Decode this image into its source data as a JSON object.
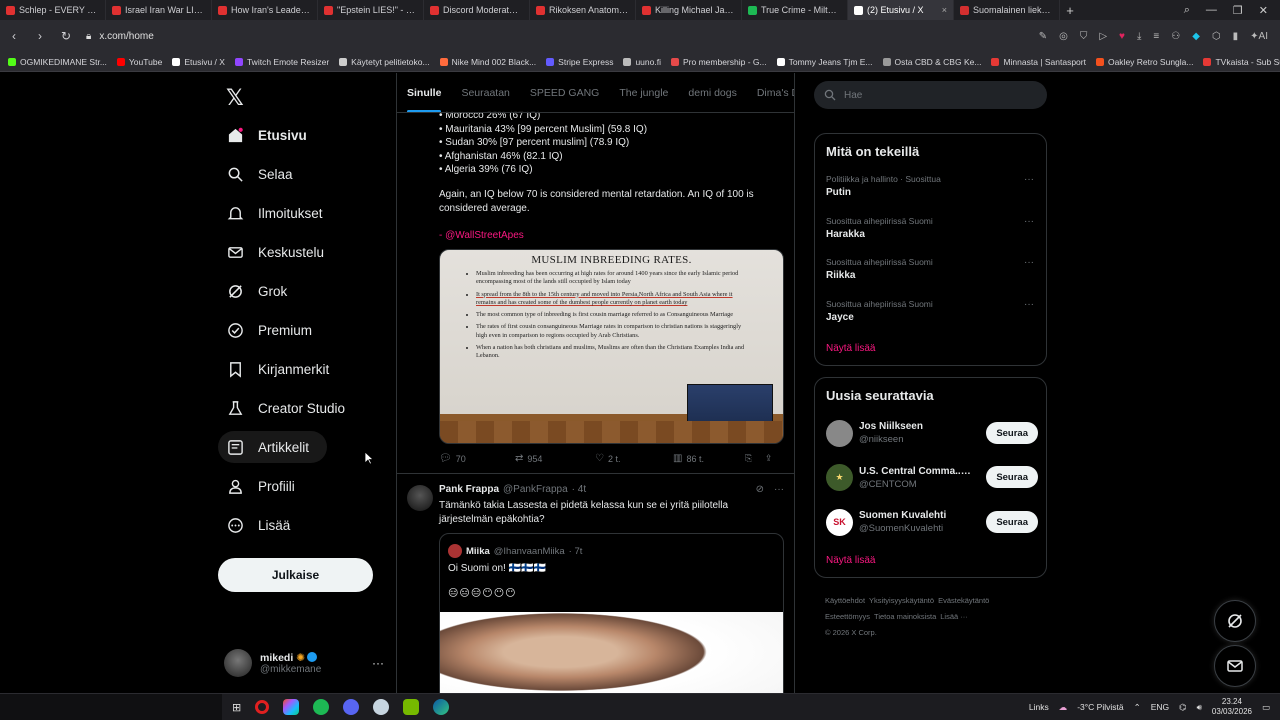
{
  "browser": {
    "tabs": [
      {
        "label": "Schlep - EVERY Parent N",
        "color": "#e03131"
      },
      {
        "label": "Israel Iran War LIVE | Seri",
        "color": "#e03131"
      },
      {
        "label": "How Iran's Leader Was Ki",
        "color": "#e03131"
      },
      {
        "label": "\"Epstein LIES!\" - CIA John",
        "color": "#e03131"
      },
      {
        "label": "Discord Moderator Gets",
        "color": "#e03131"
      },
      {
        "label": "Rikoksen Anatomia | Jam",
        "color": "#e03131"
      },
      {
        "label": "Killing Michael Jackson T",
        "color": "#e03131"
      },
      {
        "label": "True Crime - Miltä tuntu",
        "color": "#1db954"
      },
      {
        "label": "(2) Etusivu / X",
        "color": "#ffffff"
      },
      {
        "label": "Suomalainen liekeissä C",
        "color": "#d32f2f"
      }
    ],
    "url": "x.com/home",
    "bookmarks": [
      {
        "label": "OGMIKEDIMANE Str...",
        "color": "#53fc18"
      },
      {
        "label": "YouTube",
        "color": "#ff0000"
      },
      {
        "label": "Etusivu / X",
        "color": "#ffffff"
      },
      {
        "label": "Twitch Emote Resizer",
        "color": "#9146ff"
      },
      {
        "label": "Käytetyt pelitietoko...",
        "color": "#cccccc"
      },
      {
        "label": "Nike Mind 002 Black...",
        "color": "#ff6b3d"
      },
      {
        "label": "Stripe Express",
        "color": "#635bff"
      },
      {
        "label": "uuno.fi",
        "color": "#bbbbbb"
      },
      {
        "label": "Pro membership - G...",
        "color": "#e64a4a"
      },
      {
        "label": "Tommy Jeans Tjm E...",
        "color": "#ffffff"
      },
      {
        "label": "Osta CBD & CBG Ke...",
        "color": "#999999"
      },
      {
        "label": "Minnasta | Santasport",
        "color": "#e53935"
      },
      {
        "label": "Oakley Retro Sungla...",
        "color": "#f4511e"
      },
      {
        "label": "TVkaista - Sub Suara",
        "color": "#e53935"
      }
    ]
  },
  "nav": {
    "items": [
      {
        "label": "Etusivu",
        "icon": "home-icon",
        "bold": true
      },
      {
        "label": "Selaa",
        "icon": "search-icon"
      },
      {
        "label": "Ilmoitukset",
        "icon": "bell-icon"
      },
      {
        "label": "Keskustelu",
        "icon": "mail-icon"
      },
      {
        "label": "Grok",
        "icon": "grok-icon"
      },
      {
        "label": "Premium",
        "icon": "premium-icon"
      },
      {
        "label": "Kirjanmerkit",
        "icon": "bookmark-icon"
      },
      {
        "label": "Creator Studio",
        "icon": "creator-studio-icon"
      },
      {
        "label": "Artikkelit",
        "icon": "articles-icon"
      },
      {
        "label": "Profiili",
        "icon": "profile-icon"
      },
      {
        "label": "Lisää",
        "icon": "more-icon"
      }
    ],
    "post_label": "Julkaise",
    "account": {
      "name": "mikedi",
      "handle": "@mikkemane"
    }
  },
  "feed": {
    "tabs": [
      "Sinulle",
      "Seuraatan",
      "SPEED GANG",
      "The jungle",
      "demi dogs",
      "Dima's Dist"
    ],
    "tweet1": {
      "lines": [
        "• Morocco 26% (67 IQ)",
        "• Mauritania 43% [99 percent Muslim] (59.8 IQ)",
        "• Sudan 30% [97 percent muslim] (78.9 IQ)",
        "• Afghanistan 46% (82.1 IQ)",
        "• Algeria 39% (76 IQ)"
      ],
      "para": "Again, an IQ below 70 is considered mental retardation. An IQ of 100 is considered average.",
      "mention_prefix": "- ",
      "mention": "@WallStreetApes",
      "image": {
        "title": "MUSLIM INBREEDING RATES.",
        "bullets": [
          "Muslim inbreeding has been occurring at high rates for around 1400 years since the early Islamic period encompassing most of the lands still occupied by Islam today",
          "It spread from the 8th to the 15th century and moved into Persia,North Africa and South Asia where it remains and has created some of the dumbest people currently on planet earth today",
          "The most common type of inbreeding is first cousin marriage referred to as Consanguineous Marriage",
          "The rates of first cousin consanguineous Marriage rates in comparison to christian nations is staggeringly high even in comparison to regions occupied by Arab Christians.",
          "When a nation has both christians and muslims, Muslims are often than the Christians  Examples India and Lebanon."
        ]
      },
      "actions": {
        "replies": "70",
        "reposts": "954",
        "likes": "2 t.",
        "views": "86 t."
      }
    },
    "tweet2": {
      "name": "Pank Frappa",
      "handle": "@PankFrappa",
      "time": "· 4t",
      "text": "Tämänkö takia Lassesta ei pidetä kelassa kun se ei yritä piilotella järjestelmän epäkohtia?",
      "quote": {
        "name": "Miika",
        "handle": "@IhanvaanMiika",
        "time": "· 7t",
        "text": "Oi Suomi on! 🇫🇮🇫🇮🇫🇮",
        "emoji": "😑😑😑😶😶😶"
      }
    }
  },
  "right": {
    "search_placeholder": "Hae",
    "trends_title": "Mitä on tekeillä",
    "trends": [
      {
        "context": "Politiikka ja hallinto · Suosittua",
        "topic": "Putin"
      },
      {
        "context": "Suosittua aihepiirissä Suomi",
        "topic": "Harakka"
      },
      {
        "context": "Suosittua aihepiirissä Suomi",
        "topic": "Riikka"
      },
      {
        "context": "Suosittua aihepiirissä Suomi",
        "topic": "Jayce"
      }
    ],
    "show_more": "Näytä lisää",
    "follow_title": "Uusia seurattavia",
    "follows": [
      {
        "name": "Jos Niilkseen",
        "handle": "@niikseen",
        "verified": false,
        "avatar_color": "#888888",
        "initials": ""
      },
      {
        "name": "U.S. Central Comma...",
        "handle": "@CENTCOM",
        "verified": true,
        "avatar_color": "#3d5a2a",
        "initials": "★"
      },
      {
        "name": "Suomen Kuvalehti",
        "handle": "@SuomenKuvalehti",
        "verified": false,
        "avatar_color": "#ffffff",
        "initials": "SK"
      }
    ],
    "follow_label": "Seuraa",
    "footer": [
      "Käyttöehdot",
      "Yksityisyyskäytäntö",
      "Evästekäytäntö",
      "Esteettömyys",
      "Tietoa mainoksista",
      "Lisää ···",
      "© 2026 X Corp."
    ]
  },
  "taskbar": {
    "links": "Links",
    "weather": "-3°C  Pilvistä",
    "lang": "ENG",
    "time": "23.24",
    "date": "03/03/2026"
  }
}
